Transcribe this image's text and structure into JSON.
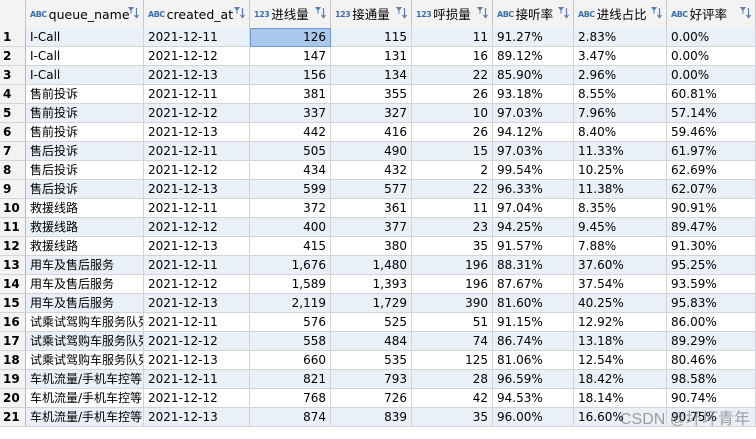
{
  "columns": [
    {
      "label": "queue_name",
      "type_icon": "ABC",
      "align": "txt"
    },
    {
      "label": "created_at",
      "type_icon": "ABC",
      "align": "txt"
    },
    {
      "label": "进线量",
      "type_icon": "123",
      "align": "num"
    },
    {
      "label": "接通量",
      "type_icon": "123",
      "align": "num"
    },
    {
      "label": "呼损量",
      "type_icon": "123",
      "align": "num"
    },
    {
      "label": "接听率",
      "type_icon": "ABC",
      "align": "txt"
    },
    {
      "label": "进线占比",
      "type_icon": "ABC",
      "align": "txt"
    },
    {
      "label": "好评率",
      "type_icon": "ABC",
      "align": "txt"
    }
  ],
  "rows": [
    [
      "1",
      "I-Call",
      "2021-12-11",
      "126",
      "115",
      "11",
      "91.27%",
      "2.83%",
      "0.00%"
    ],
    [
      "2",
      "I-Call",
      "2021-12-12",
      "147",
      "131",
      "16",
      "89.12%",
      "3.47%",
      "0.00%"
    ],
    [
      "3",
      "I-Call",
      "2021-12-13",
      "156",
      "134",
      "22",
      "85.90%",
      "2.96%",
      "0.00%"
    ],
    [
      "4",
      "售前投诉",
      "2021-12-11",
      "381",
      "355",
      "26",
      "93.18%",
      "8.55%",
      "60.81%"
    ],
    [
      "5",
      "售前投诉",
      "2021-12-12",
      "337",
      "327",
      "10",
      "97.03%",
      "7.96%",
      "57.14%"
    ],
    [
      "6",
      "售前投诉",
      "2021-12-13",
      "442",
      "416",
      "26",
      "94.12%",
      "8.40%",
      "59.46%"
    ],
    [
      "7",
      "售后投诉",
      "2021-12-11",
      "505",
      "490",
      "15",
      "97.03%",
      "11.33%",
      "61.97%"
    ],
    [
      "8",
      "售后投诉",
      "2021-12-12",
      "434",
      "432",
      "2",
      "99.54%",
      "10.25%",
      "62.69%"
    ],
    [
      "9",
      "售后投诉",
      "2021-12-13",
      "599",
      "577",
      "22",
      "96.33%",
      "11.38%",
      "62.07%"
    ],
    [
      "10",
      "救援线路",
      "2021-12-11",
      "372",
      "361",
      "11",
      "97.04%",
      "8.35%",
      "90.91%"
    ],
    [
      "11",
      "救援线路",
      "2021-12-12",
      "400",
      "377",
      "23",
      "94.25%",
      "9.45%",
      "89.47%"
    ],
    [
      "12",
      "救援线路",
      "2021-12-13",
      "415",
      "380",
      "35",
      "91.57%",
      "7.88%",
      "91.30%"
    ],
    [
      "13",
      "用车及售后服务",
      "2021-12-11",
      "1,676",
      "1,480",
      "196",
      "88.31%",
      "37.60%",
      "95.25%"
    ],
    [
      "14",
      "用车及售后服务",
      "2021-12-12",
      "1,589",
      "1,393",
      "196",
      "87.67%",
      "37.54%",
      "93.59%"
    ],
    [
      "15",
      "用车及售后服务",
      "2021-12-13",
      "2,119",
      "1,729",
      "390",
      "81.60%",
      "40.25%",
      "95.83%"
    ],
    [
      "16",
      "试乘试驾购车服务队列",
      "2021-12-11",
      "576",
      "525",
      "51",
      "91.15%",
      "12.92%",
      "86.00%"
    ],
    [
      "17",
      "试乘试驾购车服务队列",
      "2021-12-12",
      "558",
      "484",
      "74",
      "86.74%",
      "13.18%",
      "89.29%"
    ],
    [
      "18",
      "试乘试驾购车服务队列",
      "2021-12-13",
      "660",
      "535",
      "125",
      "81.06%",
      "12.54%",
      "80.46%"
    ],
    [
      "19",
      "车机流量/手机车控等问题",
      "2021-12-11",
      "821",
      "793",
      "28",
      "96.59%",
      "18.42%",
      "98.58%"
    ],
    [
      "20",
      "车机流量/手机车控等问题",
      "2021-12-12",
      "768",
      "726",
      "42",
      "94.53%",
      "18.14%",
      "90.74%"
    ],
    [
      "21",
      "车机流量/手机车控等问题",
      "2021-12-13",
      "874",
      "839",
      "35",
      "96.00%",
      "16.60%",
      "90.75%"
    ]
  ],
  "selected_cell": {
    "row": 0,
    "col": 3
  },
  "watermark": "CSDN @坏坏青年",
  "colors": {
    "header_bg": "#f3f3f3",
    "stripe": "#eaf0f8",
    "selected": "#a9c8ec",
    "type_badge": "#3b6fb0"
  }
}
